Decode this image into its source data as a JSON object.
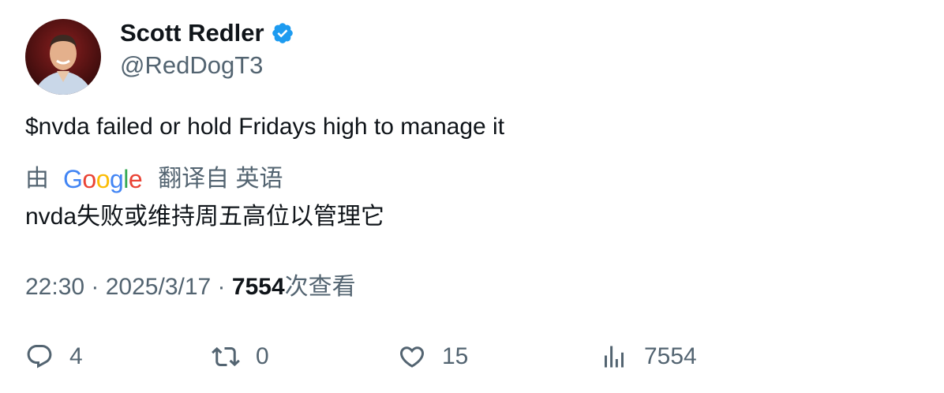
{
  "author": {
    "name": "Scott Redler",
    "handle": "@RedDogT3",
    "verified_color": "#1d9bf0"
  },
  "tweet": {
    "text": "$nvda failed or hold Fridays high to manage it"
  },
  "translation": {
    "by_label": "由",
    "provider": "Google",
    "from_label": "翻译自 英语",
    "text": "nvda失败或维持周五高位以管理它"
  },
  "meta": {
    "time": "22:30",
    "sep1": " · ",
    "date": "2025/3/17",
    "sep2": " · ",
    "views_count": "7554",
    "views_label": "次查看"
  },
  "actions": {
    "replies": "4",
    "retweets": "0",
    "likes": "15",
    "views": "7554"
  },
  "icons": {
    "reply": "reply-icon",
    "retweet": "retweet-icon",
    "like": "heart-icon",
    "views": "views-chart-icon",
    "verified": "verified-badge-icon"
  }
}
